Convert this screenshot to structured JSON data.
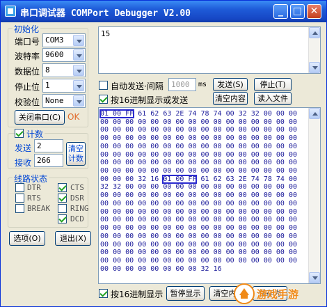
{
  "window": {
    "title": "串口调试器 COMPort Debugger V2.00",
    "buttons": {
      "minimize": "_",
      "maximize": "□",
      "close": "✕"
    }
  },
  "init": {
    "group_title": "初始化",
    "port_label": "端口号",
    "port_value": "COM3",
    "baud_label": "波特率",
    "baud_value": "9600",
    "databits_label": "数据位",
    "databits_value": "8",
    "stopbits_label": "停止位",
    "stopbits_value": "1",
    "parity_label": "校验位",
    "parity_value": "None",
    "close_port_button": "关闭串口(C)",
    "status": "OK"
  },
  "count": {
    "group_title": "计数",
    "checked": true,
    "send_label": "发送",
    "send_value": "2",
    "recv_label": "接收",
    "recv_value": "266",
    "clear_button_line1": "清空",
    "clear_button_line2": "计数"
  },
  "line_status": {
    "group_title": "线路状态",
    "items": [
      {
        "label": "DTR",
        "checked": false
      },
      {
        "label": "CTS",
        "checked": true
      },
      {
        "label": "RTS",
        "checked": false
      },
      {
        "label": "DSR",
        "checked": true
      },
      {
        "label": "BREAK",
        "checked": false
      },
      {
        "label": "RING",
        "checked": false
      },
      {
        "label": "DCD",
        "checked": true
      }
    ]
  },
  "bottom_buttons": {
    "options": "选项(O)",
    "exit": "退出(X)"
  },
  "send": {
    "text": "15",
    "auto_send_label": "自动发送·间隔",
    "auto_send_checked": false,
    "interval_value": "1000",
    "interval_unit": "ms",
    "hex_send_label": "按16进制显示或发送",
    "hex_send_checked": true,
    "send_button": "发送(S)",
    "stop_button": "停止(T)",
    "clear_content_button": "清空内容",
    "read_file_button": "读入文件"
  },
  "receive": {
    "lines": [
      "01 00 FF 61 62 63 2E 74 78 74 00 32 32 00 00 00",
      "00 00 00 00 00 00 00 00 00 00 00 00 00 00 00 00",
      "00 00 00 00 00 00 00 00 00 00 00 00 00 00 00 00",
      "00 00 00 00 00 00 00 00 00 00 00 00 00 00 00 00",
      "00 00 00 00 00 00 00 00 00 00 00 00 00 00 00 00",
      "00 00 00 00 00 00 00 00 00 00 00 00 00 00 00 00",
      "00 00 00 00 00 00 00 00 00 00 00 00 00 00 00 00",
      "00 00 00 00 00 00 00 00 00 00 00 00 00 00 00 00",
      "00 00 00 32 16 01 00 FF 61 62 63 2E 74 78 74 00",
      "32 32 00 00 00 00 00 00 00 00 00 00 00 00 00 00",
      "00 00 00 00 00 00 00 00 00 00 00 00 00 00 00 00",
      "00 00 00 00 00 00 00 00 00 00 00 00 00 00 00 00",
      "00 00 00 00 00 00 00 00 00 00 00 00 00 00 00 00",
      "00 00 00 00 00 00 00 00 00 00 00 00 00 00 00 00",
      "00 00 00 00 00 00 00 00 00 00 00 00 00 00 00 00",
      "00 00 00 00 00 00 00 00 00 00 00 00 00 00 00 00",
      "00 00 00 00 00 00 00 00 00 00 00 00 00 00 00 00",
      "00 00 00 00 00 00 00 00 00 00 00 00 00 00 00 00",
      "00 00 00 00 00 00 00 00 00 00 00 00 00 00 00 00",
      "00 00 00 00 00 00 00 00 32 16"
    ],
    "highlights": [
      {
        "line": 0,
        "start": 0,
        "length": 3
      },
      {
        "line": 8,
        "start": 5,
        "length": 3
      }
    ]
  },
  "footer": {
    "hex_display_label": "按16进制显示",
    "hex_display_checked": true,
    "pause_button": "暂停显示",
    "clear_button": "清空内容",
    "save_button": "保存为"
  },
  "watermark": {
    "text": "游戏手游",
    "colors": {
      "orange": "#f08a18"
    }
  }
}
